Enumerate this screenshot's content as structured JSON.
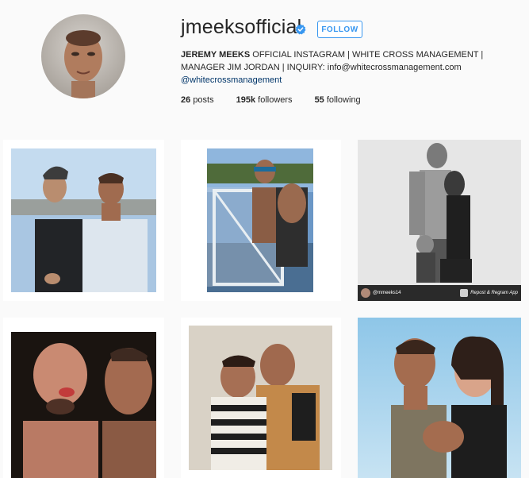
{
  "profile": {
    "username": "jmeeksofficial",
    "verified_icon": "verified-badge-icon",
    "follow_label": "FOLLOW",
    "bio_name": "JEREMY MEEKS",
    "bio_line1_rest": " OFFICIAL INSTAGRAM | WHITE CROSS MANAGEMENT |",
    "bio_line2": "MANAGER JIM JORDAN | INQUIRY: info@whitecrossmanagement.com",
    "bio_handle": "@whitecrossmanagement",
    "posts_count": "26",
    "posts_label": "posts",
    "followers_count": "195k",
    "followers_label": "followers",
    "following_count": "55",
    "following_label": "following"
  },
  "posts": [
    {
      "name": "post-1"
    },
    {
      "name": "post-2"
    },
    {
      "name": "post-3",
      "overlay_handle": "@mmeeks14",
      "overlay_app": "Repost & Regram App"
    },
    {
      "name": "post-4"
    },
    {
      "name": "post-5"
    },
    {
      "name": "post-6"
    }
  ],
  "colors": {
    "accent": "#3897f0",
    "background": "#fafafa",
    "link": "#003569"
  }
}
